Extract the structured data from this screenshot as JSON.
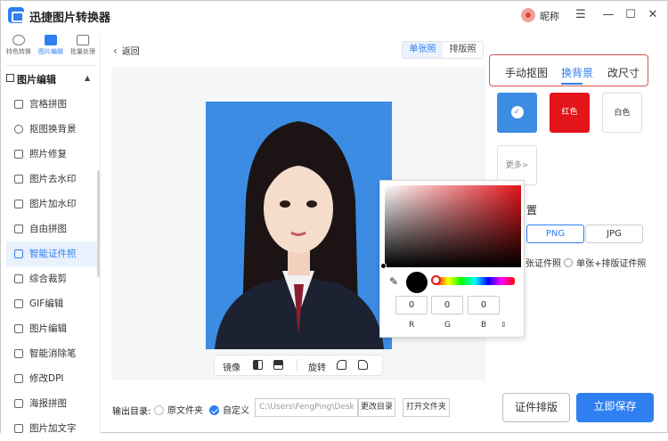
{
  "app": {
    "title": "迅捷图片转换器",
    "nickname": "昵称"
  },
  "rail": {
    "top_icons": [
      "特色转换",
      "图片编辑",
      "批量处理"
    ],
    "section": "图片编辑",
    "items": [
      "宫格拼图",
      "抠图换背景",
      "照片修复",
      "图片去水印",
      "图片加水印",
      "自由拼图",
      "智能证件照",
      "综合裁剪",
      "GIF编辑",
      "图片编辑",
      "智能消除笔",
      "修改DPI",
      "海报拼图",
      "图片加文字"
    ],
    "active_item": "智能证件照"
  },
  "main": {
    "back_label": "返回",
    "view_modes": [
      "单张照",
      "排版照"
    ],
    "tools": {
      "mirror": "镜像",
      "rotate": "旋转"
    }
  },
  "picker": {
    "r": "0",
    "g": "0",
    "b": "0",
    "labels": [
      "R",
      "G",
      "B"
    ]
  },
  "panel": {
    "tabs": [
      "手动抠图",
      "换背景",
      "改尺寸"
    ],
    "active_tab": "换背景",
    "swatches": [
      {
        "label": "",
        "color": "#3c8ce3"
      },
      {
        "label": "红色",
        "color": "#e3151a"
      },
      {
        "label": "白色",
        "color": "#ffffff"
      }
    ],
    "more": "更多>",
    "format_label": "置",
    "formats": [
      "PNG",
      "JPG"
    ],
    "layout_options": [
      "张证件照",
      "单张+排版证件照"
    ]
  },
  "footer": {
    "output_label": "输出目录:",
    "opt_source": "原文件夹",
    "opt_custom": "自定义",
    "path": "C:\\Users\\FengPing\\Desk",
    "change_dir": "更改目录",
    "open_folder": "打开文件夹",
    "layout_btn": "证件排版",
    "save_btn": "立即保存"
  }
}
